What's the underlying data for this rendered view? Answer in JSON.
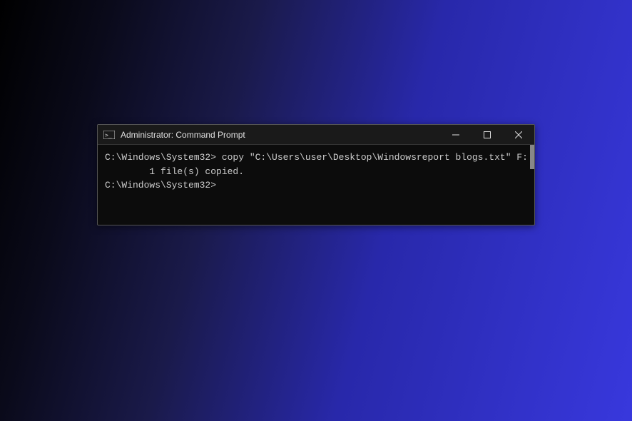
{
  "window": {
    "title": "Administrator: Command Prompt",
    "icon_name": "cmd-icon"
  },
  "terminal": {
    "line1": "C:\\Windows\\System32> copy \"C:\\Users\\user\\Desktop\\Windowsreport blogs.txt\" F:",
    "line2": "        1 file(s) copied.",
    "line3": "",
    "line4": "C:\\Windows\\System32>"
  }
}
